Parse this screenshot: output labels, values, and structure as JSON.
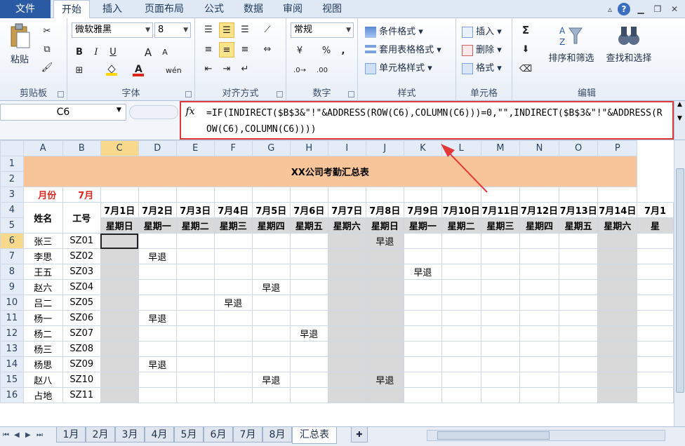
{
  "tabs": {
    "file": "文件",
    "items": [
      "开始",
      "插入",
      "页面布局",
      "公式",
      "数据",
      "审阅",
      "视图"
    ],
    "active": "开始"
  },
  "ribbon": {
    "clipboard": {
      "label": "剪贴板",
      "paste": "粘贴"
    },
    "font": {
      "label": "字体",
      "name": "微软雅黑",
      "size": "8",
      "bold": "B",
      "italic": "I",
      "underline": "U",
      "grow": "A",
      "shrink": "A",
      "fill_color": "#ffd600",
      "font_color": "#e0241b",
      "wen": "wén"
    },
    "alignment": {
      "label": "对齐方式"
    },
    "number": {
      "label": "数字",
      "format": "常规",
      "percent": "%",
      "comma": ","
    },
    "styles": {
      "label": "样式",
      "conditional": "条件格式",
      "table": "套用表格格式",
      "cell": "单元格样式"
    },
    "cells": {
      "label": "单元格",
      "insert": "插入",
      "delete": "删除",
      "format": "格式"
    },
    "editing": {
      "label": "编辑",
      "sigma": "Σ",
      "sort": "排序和筛选",
      "find": "查找和选择"
    }
  },
  "formula_bar": {
    "name_box": "C6",
    "fx": "fx",
    "formula": "=IF(INDIRECT($B$3&\"!\"&ADDRESS(ROW(C6),COLUMN(C6)))=0,\"\",INDIRECT($B$3&\"!\"&ADDRESS(ROW(C6),COLUMN(C6))))"
  },
  "sheet": {
    "columns": [
      "A",
      "B",
      "C",
      "D",
      "E",
      "F",
      "G",
      "H",
      "I",
      "J",
      "K",
      "L",
      "M",
      "N",
      "O",
      "P"
    ],
    "rows": [
      "1",
      "2",
      "3",
      "4",
      "5",
      "6",
      "7",
      "8",
      "9",
      "10",
      "11",
      "12",
      "13",
      "14",
      "15",
      "16"
    ],
    "title": "XX公司考勤汇总表",
    "month_label": "月份",
    "month_value": "7月",
    "name_header": "姓名",
    "id_header": "工号",
    "dates": [
      "7月1日",
      "7月2日",
      "7月3日",
      "7月4日",
      "7月5日",
      "7月6日",
      "7月7日",
      "7月8日",
      "7月9日",
      "7月10日",
      "7月11日",
      "7月12日",
      "7月13日",
      "7月14日",
      "7月1"
    ],
    "weekdays": [
      "星期日",
      "星期一",
      "星期二",
      "星期三",
      "星期四",
      "星期五",
      "星期六",
      "星期日",
      "星期一",
      "星期二",
      "星期三",
      "星期四",
      "星期五",
      "星期六",
      "星"
    ],
    "weekend_cols": [
      0,
      6,
      7,
      13
    ],
    "employees": [
      {
        "name": "张三",
        "id": "SZ01",
        "marks": {
          "7": "早退"
        }
      },
      {
        "name": "李思",
        "id": "SZ02",
        "marks": {
          "1": "早退"
        }
      },
      {
        "name": "王五",
        "id": "SZ03",
        "marks": {
          "8": "早退"
        }
      },
      {
        "name": "赵六",
        "id": "SZ04",
        "marks": {
          "4": "早退"
        }
      },
      {
        "name": "吕二",
        "id": "SZ05",
        "marks": {
          "3": "早退"
        }
      },
      {
        "name": "杨一",
        "id": "SZ06",
        "marks": {
          "1": "早退"
        }
      },
      {
        "name": "杨二",
        "id": "SZ07",
        "marks": {
          "5": "早退"
        }
      },
      {
        "name": "杨三",
        "id": "SZ08",
        "marks": {}
      },
      {
        "name": "杨思",
        "id": "SZ09",
        "marks": {
          "1": "早退"
        }
      },
      {
        "name": "赵八",
        "id": "SZ10",
        "marks": {
          "4": "早退",
          "7": "早退"
        }
      },
      {
        "name": "占地",
        "id": "SZ11",
        "marks": {}
      }
    ]
  },
  "sheet_tabs": [
    "1月",
    "2月",
    "3月",
    "4月",
    "5月",
    "6月",
    "7月",
    "8月",
    "汇总表"
  ],
  "active_sheet": "汇总表"
}
